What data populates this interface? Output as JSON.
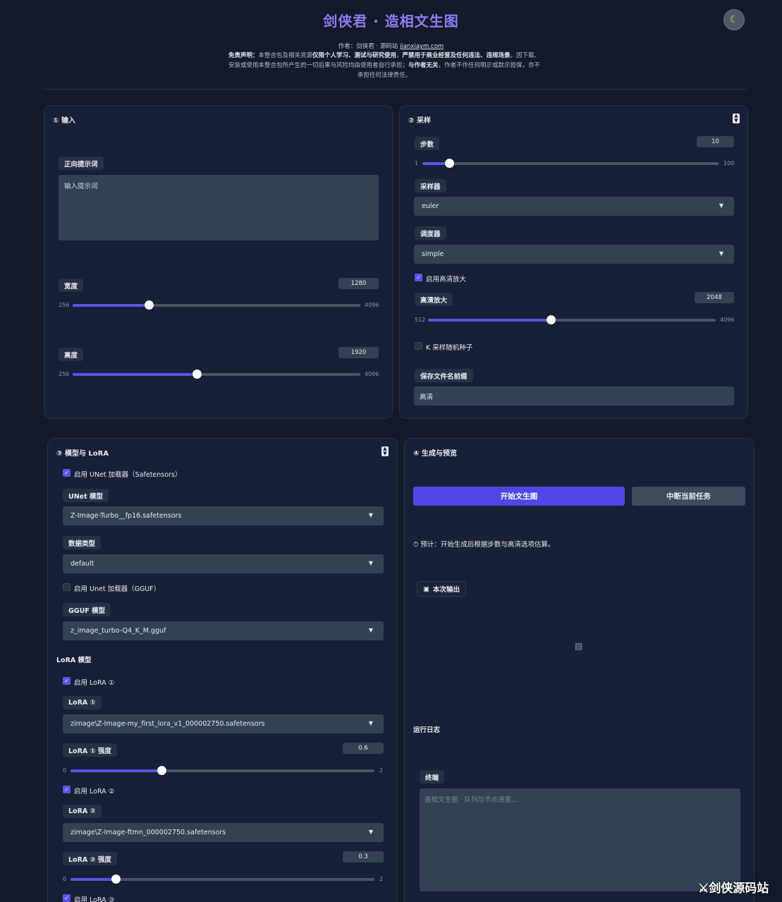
{
  "header": {
    "title": "剑侠君 · 造相文生图",
    "theme_icon": "☾",
    "author_prefix": "作者：剑侠君 · 源码站 ",
    "author_link": "jianxiaym.com",
    "disclaimer_label": "免责声明：",
    "disclaimer_1": "本整合包及相关资源",
    "disclaimer_2": "仅限个人学习、测试与研究使用",
    "disclaimer_3": "，",
    "disclaimer_4": "严禁用于商业经营及任何违法、违规场景",
    "disclaimer_5": "。因下载、安装或使用本整合包所产生的一切后果与风险均由使用者自行承担；",
    "disclaimer_6": "与作者无关",
    "disclaimer_7": "，作者不作任何明示或默示担保，亦不承担任何法律责任。"
  },
  "input_panel": {
    "title": "① 输入",
    "prompt_label": "正向提示词",
    "prompt_placeholder": "输入提示词",
    "width": {
      "label": "宽度",
      "value": "1280",
      "min": "256",
      "max": "4096",
      "fraction": 0.2667
    },
    "height": {
      "label": "高度",
      "value": "1920",
      "min": "256",
      "max": "4096",
      "fraction": 0.4333
    }
  },
  "sampling_panel": {
    "title": "② 采样",
    "steps": {
      "label": "步数",
      "value": "10",
      "min": "1",
      "max": "100",
      "fraction": 0.0909
    },
    "sampler_label": "采样器",
    "sampler_value": "euler",
    "scheduler_label": "调度器",
    "scheduler_value": "simple",
    "hd_check_label": "启用高清放大",
    "hd": {
      "label": "高清放大",
      "value": "2048",
      "min": "512",
      "max": "4096",
      "fraction": 0.4286
    },
    "random_seed_label": "K 采样随机种子",
    "prefix_label": "保存文件名前缀",
    "prefix_value": "高清"
  },
  "model_panel": {
    "title": "③ 模型与 LoRA",
    "unet_check_label": "启用 UNet 加载器（Safetensors）",
    "unet_model_label": "UNet 模型",
    "unet_model_value": "Z-Image-Turbo__fp16.safetensors",
    "dtype_label": "数据类型",
    "dtype_value": "default",
    "gguf_check_label": "启用 Unet 加载器（GGUF）",
    "gguf_model_label": "GGUF 模型",
    "gguf_model_value": "z_image_turbo-Q4_K_M.gguf",
    "lora_section_label": "LoRA 模型",
    "lora1_check_label": "启用 LoRA ①",
    "lora1_label": "LoRA ①",
    "lora1_value": "zimage\\Z-Image-my_first_lora_v1_000002750.safetensors",
    "lora1_strength": {
      "label": "LoRA ① 强度",
      "value": "0.6",
      "min": "0",
      "max": "2",
      "fraction": 0.3
    },
    "lora2_check_label": "启用 LoRA ②",
    "lora2_label": "LoRA ②",
    "lora2_value": "zimage\\Z-Image-ftmn_000002750.safetensors",
    "lora2_strength": {
      "label": "LoRA ② 强度",
      "value": "0.3",
      "min": "0",
      "max": "2",
      "fraction": 0.15
    },
    "lora3_check_label": "启用 LoRA ③"
  },
  "generate_panel": {
    "title": "④ 生成与预览",
    "start_button": "开始文生图",
    "stop_button": "中断当前任务",
    "estimate_text": "⏱ 预计：开始生成后根据步数与高清选项估算。",
    "output_label": "本次输出",
    "log_label": "运行日志",
    "terminal_label": "终端",
    "terminal_placeholder": "造相文生图 · 队列与节点进度…"
  },
  "watermark": "⚔剑侠源码站",
  "colors": {
    "accent": "#5046e5",
    "title": "#8f7df0",
    "background": "#121a2b",
    "panel": "#172036"
  }
}
